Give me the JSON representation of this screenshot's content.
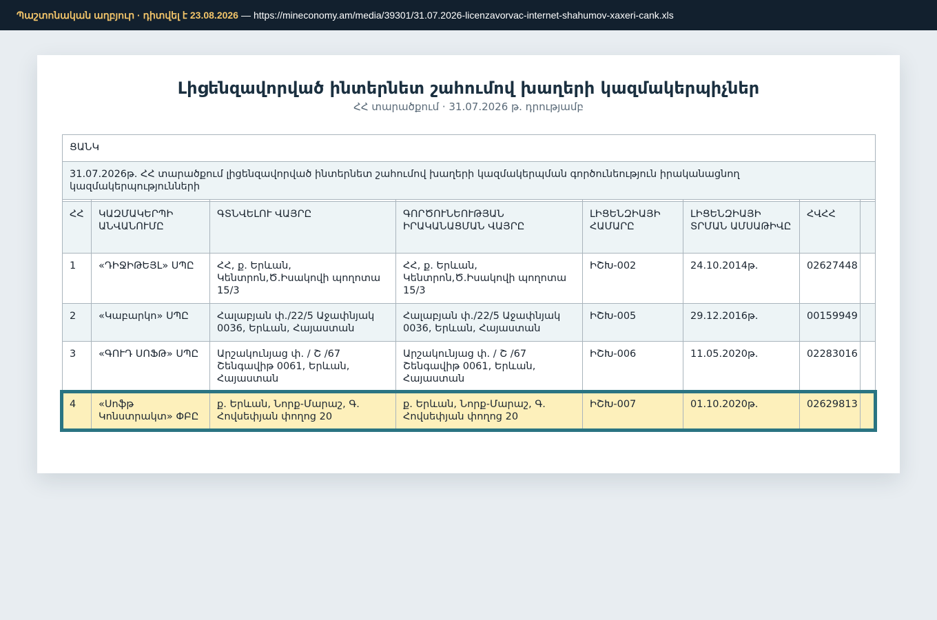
{
  "topbar": {
    "source_label": "Պաշտոնական աղբյուր · դիտվել է 23.08.2026",
    "separator": "—",
    "url": "https://mineconomy.am/media/39301/31.07.2026-licenzavorvac-internet-shahumov-xaxeri-cank.xls"
  },
  "document": {
    "title": "Լիցենզավորված ինտերնետ շահումով խաղերի կազմակերպիչներ",
    "subtitle": "ՀՀ տարածքում · 31.07.2026 թ. դրությամբ",
    "caption": "ՑԱՆԿ",
    "description": "31.07.2026թ. ՀՀ տարածքում լիցենզավորված ինտերնետ շահումով խաղերի կազմակերպման գործունեություն իրականացնող կազմակերպությունների"
  },
  "table": {
    "headers": [
      "ՀՀ",
      "ԿԱԶՄԱԿԵՐՊԻ ԱՆՎԱՆՈՒՄԸ",
      "ԳՏՆՎԵԼՈՒ ՎԱՅՐԸ",
      "ԳՈՐԾՈՒՆԵՈՒԹՅԱՆ ԻՐԱԿԱՆԱՑՄԱՆ ՎԱՅՐԸ",
      "ԼԻՑԵՆԶԻԱՅԻ ՀԱՄԱՐԸ",
      "ԼԻՑԵՆԶԻԱՅԻ ՏՐՄԱՆ ԱՄՍԱԹԻՎԸ",
      "ՀՎՀՀ",
      ""
    ],
    "rows": [
      {
        "no": "1",
        "name": "«ԴԻՋԻԹԵՅԼ» ՍՊԸ",
        "address": "ՀՀ, ք. Երևան, Կենտրոն,Ծ.Իսակովի պողոտա 15/3",
        "activity": "ՀՀ, ք. Երևան, Կենտրոն,Ծ.Իսակովի պողոտա 15/3",
        "license": "ԻՇԽ-002",
        "date": "24.10.2014թ.",
        "tin": "02627448",
        "extra": ""
      },
      {
        "no": "2",
        "name": "«Կաբարկո» ՍՊԸ",
        "address": "Հալաբյան փ./22/5 Աջափնյակ 0036, Երևան, Հայաստան",
        "activity": "Հալաբյան փ./22/5 Աջափնյակ 0036, Երևան, Հայաստան",
        "license": "ԻՇԽ-005",
        "date": "29.12.2016թ.",
        "tin": "00159949",
        "extra": ""
      },
      {
        "no": "3",
        "name": "«ԳՈՒԴ ՍՈՖԹ» ՍՊԸ",
        "address": "Արշակունյաց փ. / Շ /67 Շենգավիթ 0061, Երևան, Հայաստան",
        "activity": "Արշակունյաց փ. / Շ /67 Շենգավիթ 0061, Երևան, Հայաստան",
        "license": "ԻՇԽ-006",
        "date": "11.05.2020թ.",
        "tin": "02283016",
        "extra": ""
      },
      {
        "no": "4",
        "name": "«Սոֆթ Կոնստրակտ» ՓԲԸ",
        "address": "ք. Երևան, Նորք-Մարաշ, Գ. Հովսեփյան փողոց 20",
        "activity": "ք. Երևան, Նորք-Մարաշ, Գ. Հովսեփյան փողոց 20",
        "license": "ԻՇԽ-007",
        "date": "01.10.2020թ.",
        "tin": "02629813",
        "extra": ""
      }
    ]
  },
  "colors": {
    "topbar_bg": "#12202e",
    "source_label": "#f3c56a",
    "highlight_border": "#2a7482",
    "highlight_fill": "#fdf0bb",
    "alt_row": "#edf4f6"
  }
}
